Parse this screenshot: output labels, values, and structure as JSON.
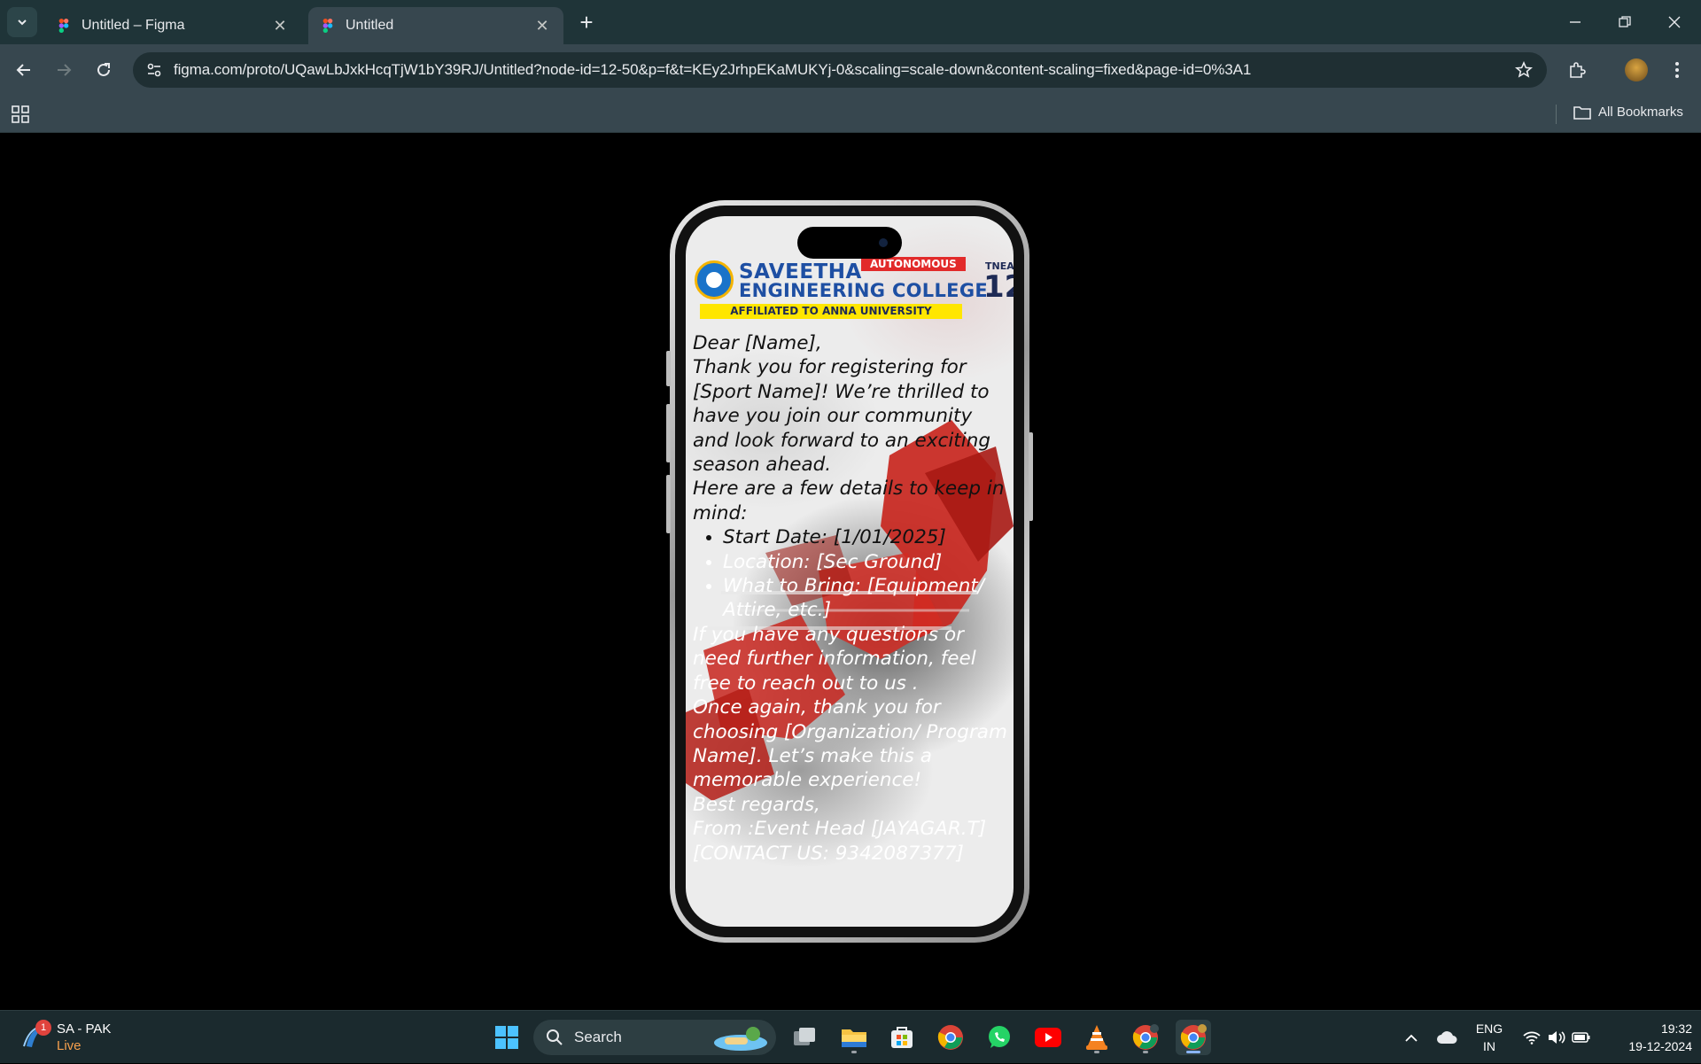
{
  "browser": {
    "tabs": [
      {
        "title": "Untitled – Figma"
      },
      {
        "title": "Untitled"
      }
    ],
    "url": "figma.com/proto/UQawLbJxkHcqTjW1bY39RJ/Untitled?node-id=12-50&p=f&t=KEy2JrhpEKaMUKYj-0&scaling=scale-down&content-scaling=fixed&page-id=0%3A1",
    "all_bookmarks": "All Bookmarks"
  },
  "banner": {
    "line1": "SAVEETHA",
    "line2": "ENGINEERING COLLEGE",
    "autonomous": "AUTONOMOUS",
    "affiliation": "AFFILIATED TO ANNA UNIVERSITY",
    "tnea": "TNEA",
    "number": "12"
  },
  "letter": {
    "greeting": "Dear [Name],",
    "intro": "Thank you for registering for [Sport Name]! We’re thrilled to have you join our community and look forward to an exciting season ahead.",
    "details_heading": "Here are a few details to keep in mind:",
    "details": [
      "Start Date: [1/01/2025]",
      "Location: [Sec Ground]",
      "What to Bring: [Equipment/ Attire, etc.]"
    ],
    "questions": "If you have any questions or need further information, feel free to reach out to us .",
    "thanks": "Once again, thank you for choosing [Organization/ Program Name]. Let’s make this a memorable experience!",
    "regards": "Best regards,",
    "from": "From :Event Head [JAYAGAR.T]",
    "contact": "[CONTACT US: 9342087377]"
  },
  "taskbar": {
    "weather_badge": "1",
    "weather_title": "SA - PAK",
    "weather_status": "Live",
    "search_label": "Search",
    "lang_line1": "ENG",
    "lang_line2": "IN",
    "time": "19:32",
    "date": "19-12-2024"
  },
  "colors": {
    "tabbar": "#1f3438",
    "toolbar": "#37474f",
    "taskbar": "#1b2a2e",
    "banner_blue": "#1e4fa3",
    "banner_red": "#e22a2a",
    "banner_yellow": "#ffe600"
  }
}
